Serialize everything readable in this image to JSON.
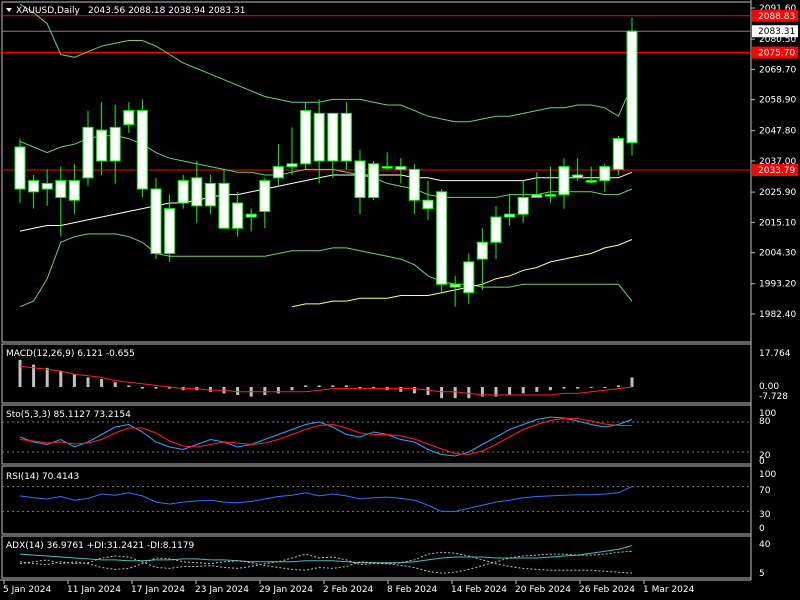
{
  "header": {
    "symbol": "XAUUSD,Daily",
    "ohlc": "2043.56 2088.18 2038.94 2083.31"
  },
  "colors": {
    "bg": "#000000",
    "bull": "#ffffff",
    "bear": "#ffffff",
    "wick": "#00ff00",
    "axis": "#c0c0c0",
    "band": "#6fcf6f",
    "ma": "#ffffff",
    "ma2": "#ffff80",
    "hline": "#ff0000",
    "macd_sig": "#ff2020",
    "sto_main": "#30a0ff",
    "sto_sig": "#ff2020",
    "rsi": "#3070ff"
  },
  "price_axis": {
    "labels": [
      "2091.60",
      "2080.50",
      "2069.70",
      "2058.90",
      "2047.80",
      "2037.00",
      "2025.90",
      "2015.10",
      "2004.30",
      "1993.20",
      "1982.40"
    ],
    "hline_labels": [
      "2088.83",
      "2075.70",
      "2033.79"
    ],
    "current": "2083.31",
    "ylim": [
      1982.4,
      2091.6
    ]
  },
  "x_axis": {
    "labels": [
      "5 Jan 2024",
      "11 Jan 2024",
      "17 Jan 2024",
      "23 Jan 2024",
      "29 Jan 2024",
      "2 Feb 2024",
      "8 Feb 2024",
      "14 Feb 2024",
      "20 Feb 2024",
      "26 Feb 2024",
      "1 Mar 2024"
    ]
  },
  "macd": {
    "title": "MACD(12,26,9) 6.121 -0.655",
    "labels": [
      "17.764",
      "0.00",
      "-7.728"
    ]
  },
  "sto": {
    "title": "Sto(5,3,3) 85.1127 73.2154",
    "labels": [
      "100",
      "80",
      "20",
      "0"
    ]
  },
  "rsi": {
    "title": "RSI(14) 70.4143",
    "labels": [
      "100",
      "70",
      "30",
      "0"
    ]
  },
  "adx": {
    "title": "ADX(14) 36.9761 +DI:31.2421 -DI:8.1179",
    "labels": [
      "40",
      "5"
    ]
  },
  "chart_data": {
    "type": "candlestick",
    "title": "XAUUSD,Daily",
    "ylim": [
      1982.4,
      2091.6
    ],
    "candles": [
      {
        "o": 2042,
        "h": 2045,
        "l": 2022,
        "c": 2027
      },
      {
        "o": 2026,
        "h": 2032,
        "l": 2020,
        "c": 2030
      },
      {
        "o": 2029,
        "h": 2034,
        "l": 2021,
        "c": 2027
      },
      {
        "o": 2030,
        "h": 2035,
        "l": 2010,
        "c": 2024
      },
      {
        "o": 2023,
        "h": 2036,
        "l": 2018,
        "c": 2030
      },
      {
        "o": 2031,
        "h": 2055,
        "l": 2028,
        "c": 2049
      },
      {
        "o": 2048,
        "h": 2058,
        "l": 2032,
        "c": 2037
      },
      {
        "o": 2037,
        "h": 2057,
        "l": 2029,
        "c": 2049
      },
      {
        "o": 2050,
        "h": 2058,
        "l": 2047,
        "c": 2055
      },
      {
        "o": 2055,
        "h": 2059,
        "l": 2024,
        "c": 2027
      },
      {
        "o": 2027,
        "h": 2031,
        "l": 2002,
        "c": 2004
      },
      {
        "o": 2004,
        "h": 2025,
        "l": 2001,
        "c": 2020
      },
      {
        "o": 2022,
        "h": 2032,
        "l": 2020,
        "c": 2030
      },
      {
        "o": 2031,
        "h": 2037,
        "l": 2015,
        "c": 2021
      },
      {
        "o": 2021,
        "h": 2032,
        "l": 2018,
        "c": 2029
      },
      {
        "o": 2029,
        "h": 2034,
        "l": 2013,
        "c": 2013
      },
      {
        "o": 2013,
        "h": 2026,
        "l": 2010,
        "c": 2022
      },
      {
        "o": 2017,
        "h": 2020,
        "l": 2012,
        "c": 2018
      },
      {
        "o": 2019,
        "h": 2031,
        "l": 2013,
        "c": 2030
      },
      {
        "o": 2031,
        "h": 2043,
        "l": 2028,
        "c": 2035
      },
      {
        "o": 2035,
        "h": 2049,
        "l": 2032,
        "c": 2036
      },
      {
        "o": 2036,
        "h": 2058,
        "l": 2034,
        "c": 2055
      },
      {
        "o": 2054,
        "h": 2059,
        "l": 2029,
        "c": 2037
      },
      {
        "o": 2037,
        "h": 2054,
        "l": 2031,
        "c": 2054
      },
      {
        "o": 2054,
        "h": 2058,
        "l": 2034,
        "c": 2037
      },
      {
        "o": 2037,
        "h": 2041,
        "l": 2018,
        "c": 2024
      },
      {
        "o": 2024,
        "h": 2037,
        "l": 2023,
        "c": 2036
      },
      {
        "o": 2035,
        "h": 2040,
        "l": 2034,
        "c": 2035
      },
      {
        "o": 2035,
        "h": 2038,
        "l": 2029,
        "c": 2034
      },
      {
        "o": 2034,
        "h": 2036,
        "l": 2018,
        "c": 2023
      },
      {
        "o": 2023,
        "h": 2030,
        "l": 2016,
        "c": 2020
      },
      {
        "o": 2026,
        "h": 2027,
        "l": 1990,
        "c": 1993
      },
      {
        "o": 1993,
        "h": 1996,
        "l": 1985,
        "c": 1992
      },
      {
        "o": 1990,
        "h": 2004,
        "l": 1986,
        "c": 2001
      },
      {
        "o": 2002,
        "h": 2013,
        "l": 1991,
        "c": 2008
      },
      {
        "o": 2008,
        "h": 2021,
        "l": 2002,
        "c": 2017
      },
      {
        "o": 2017,
        "h": 2025,
        "l": 2014,
        "c": 2018
      },
      {
        "o": 2018,
        "h": 2030,
        "l": 2015,
        "c": 2024
      },
      {
        "o": 2024,
        "h": 2033,
        "l": 2024,
        "c": 2025
      },
      {
        "o": 2025,
        "h": 2035,
        "l": 2022,
        "c": 2025
      },
      {
        "o": 2025,
        "h": 2038,
        "l": 2020,
        "c": 2035
      },
      {
        "o": 2031,
        "h": 2038,
        "l": 2030,
        "c": 2032
      },
      {
        "o": 2030,
        "h": 2035,
        "l": 2029,
        "c": 2030
      },
      {
        "o": 2030,
        "h": 2036,
        "l": 2026,
        "c": 2035
      },
      {
        "o": 2034,
        "h": 2046,
        "l": 2032,
        "c": 2045
      },
      {
        "o": 2043.56,
        "h": 2088.18,
        "l": 2038.94,
        "c": 2083.31
      }
    ],
    "hlines": [
      2088.83,
      2075.7,
      2033.79
    ],
    "bands": {
      "upper": [
        2093,
        2090,
        2086,
        2075,
        2074,
        2076,
        2078,
        2079,
        2080,
        2080,
        2078,
        2075,
        2072,
        2070,
        2068,
        2066,
        2064,
        2062,
        2060,
        2059,
        2058,
        2058,
        2058,
        2059,
        2059,
        2059,
        2058,
        2057,
        2057,
        2055,
        2053,
        2052,
        2051,
        2051,
        2052,
        2053,
        2053,
        2054,
        2055,
        2056,
        2056,
        2057,
        2057,
        2056,
        2053,
        2064
      ],
      "middle": [
        2044,
        2042,
        2040,
        2042,
        2043,
        2045,
        2046,
        2046,
        2045,
        2043,
        2040,
        2038,
        2037,
        2036,
        2035,
        2034,
        2033,
        2033,
        2032,
        2032,
        2033,
        2034,
        2034,
        2034,
        2033,
        2032,
        2031,
        2029,
        2028,
        2027,
        2025,
        2024,
        2024,
        2024,
        2024,
        2024,
        2025,
        2025,
        2025,
        2026,
        2026,
        2026,
        2026,
        2025,
        2025,
        2027
      ],
      "lower": [
        1985,
        1987,
        1995,
        2008,
        2010,
        2011,
        2011,
        2011,
        2010,
        2008,
        2004,
        2003,
        2003,
        2003,
        2003,
        2003,
        2003,
        2003,
        2003,
        2004,
        2005,
        2005,
        2005,
        2006,
        2006,
        2005,
        2004,
        2003,
        2002,
        2000,
        1996,
        1994,
        1993,
        1993,
        1992,
        1992,
        1992,
        1993,
        1993,
        1993,
        1993,
        1993,
        1993,
        1993,
        1993,
        1987
      ]
    },
    "ma_white": [
      2012,
      2013,
      2014,
      2014,
      2015,
      2016,
      2017,
      2018,
      2019,
      2020,
      2021,
      2022,
      2022,
      2023,
      2024,
      2025,
      2025,
      2026,
      2027,
      2028,
      2029,
      2030,
      2031,
      2032,
      2032,
      2032,
      2032,
      2032,
      2032,
      2031,
      2031,
      2030,
      2030,
      2030,
      2030,
      2030,
      2030,
      2030,
      2031,
      2031,
      2031,
      2031,
      2031,
      2031,
      2031,
      2033
    ],
    "ma_yellow": [
      null,
      null,
      null,
      null,
      null,
      null,
      null,
      null,
      null,
      null,
      null,
      null,
      null,
      null,
      null,
      null,
      null,
      null,
      null,
      null,
      1985,
      1986,
      1986,
      1987,
      1987,
      1988,
      1988,
      1988,
      1989,
      1989,
      1989,
      1990,
      1991,
      1992,
      1993,
      1995,
      1996,
      1998,
      1999,
      2001,
      2002,
      2003,
      2004,
      2006,
      2007,
      2009
    ],
    "macd_hist": [
      17,
      14,
      12,
      10,
      8,
      6,
      5,
      3,
      1,
      -1,
      -1,
      -1,
      -2,
      -2,
      -3,
      -4,
      -5,
      -6,
      -5,
      -4,
      -2,
      1,
      1,
      1,
      1,
      0,
      0,
      -2,
      -3,
      -4,
      -5,
      -7,
      -7,
      -7,
      -6,
      -6,
      -5,
      -4,
      -3,
      -2,
      -1,
      -1,
      0,
      0,
      1,
      6
    ],
    "macd_signal": [
      13,
      12,
      11,
      10,
      8,
      7,
      6,
      4,
      3,
      2,
      1,
      0,
      -1,
      -1,
      -2,
      -2,
      -3,
      -3,
      -3,
      -3,
      -3,
      -3,
      -2,
      -1,
      -1,
      -1,
      -1,
      -1,
      -1,
      -1,
      -2,
      -3,
      -3,
      -4,
      -5,
      -5,
      -5,
      -5,
      -5,
      -5,
      -4,
      -4,
      -3,
      -2,
      -1,
      0
    ],
    "sto_main": [
      50,
      40,
      35,
      45,
      30,
      40,
      55,
      70,
      75,
      60,
      40,
      30,
      25,
      35,
      45,
      40,
      30,
      35,
      45,
      55,
      65,
      75,
      80,
      70,
      55,
      50,
      60,
      55,
      45,
      40,
      25,
      15,
      12,
      20,
      35,
      50,
      65,
      75,
      85,
      90,
      88,
      82,
      75,
      70,
      75,
      85
    ],
    "sto_sig": [
      45,
      42,
      38,
      40,
      36,
      38,
      45,
      58,
      68,
      68,
      58,
      42,
      32,
      30,
      35,
      40,
      38,
      35,
      38,
      45,
      55,
      65,
      73,
      75,
      68,
      58,
      55,
      55,
      52,
      46,
      36,
      26,
      17,
      15,
      22,
      35,
      50,
      65,
      75,
      83,
      87,
      87,
      82,
      76,
      73,
      73
    ],
    "rsi": [
      55,
      52,
      50,
      54,
      48,
      51,
      58,
      56,
      60,
      55,
      45,
      42,
      45,
      47,
      48,
      45,
      44,
      46,
      50,
      54,
      56,
      60,
      55,
      58,
      55,
      50,
      52,
      53,
      51,
      48,
      40,
      30,
      30,
      35,
      40,
      45,
      48,
      52,
      54,
      55,
      56,
      57,
      57,
      58,
      60,
      70
    ],
    "adx": [
      28,
      27,
      26,
      25,
      24,
      23,
      22,
      22,
      21,
      21,
      22,
      22,
      23,
      23,
      22,
      22,
      21,
      20,
      20,
      20,
      20,
      21,
      21,
      21,
      20,
      19,
      19,
      19,
      19,
      20,
      22,
      24,
      25,
      25,
      25,
      24,
      24,
      24,
      24,
      25,
      26,
      27,
      29,
      31,
      33,
      37
    ],
    "di_plus": [
      20,
      18,
      17,
      20,
      18,
      19,
      24,
      26,
      25,
      20,
      14,
      13,
      15,
      15,
      16,
      14,
      13,
      15,
      18,
      20,
      24,
      28,
      24,
      25,
      22,
      17,
      18,
      18,
      16,
      14,
      10,
      8,
      9,
      12,
      16,
      20,
      24,
      26,
      27,
      28,
      28,
      27,
      27,
      28,
      30,
      31
    ],
    "di_minus": [
      18,
      20,
      22,
      18,
      20,
      18,
      14,
      12,
      13,
      18,
      24,
      23,
      20,
      19,
      18,
      20,
      21,
      19,
      16,
      14,
      12,
      11,
      14,
      13,
      15,
      20,
      19,
      18,
      19,
      22,
      28,
      30,
      29,
      26,
      22,
      18,
      15,
      13,
      12,
      11,
      11,
      11,
      11,
      10,
      9,
      8
    ]
  }
}
